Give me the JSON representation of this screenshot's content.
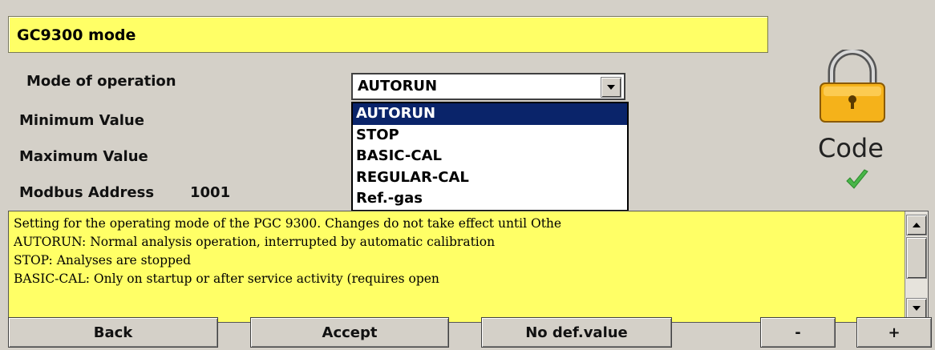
{
  "title": "GC9300 mode",
  "fields": {
    "mode_label": "Mode of operation",
    "min_label": "Minimum Value",
    "max_label": "Maximum Value",
    "modbus_label": "Modbus Address",
    "modbus_value": "1001"
  },
  "combo": {
    "selected": "AUTORUN",
    "options": [
      "AUTORUN",
      "STOP",
      "BASIC-CAL",
      "REGULAR-CAL",
      "Ref.-gas"
    ]
  },
  "right_panel": {
    "code_label": "Code",
    "lock_icon": "padlock-icon",
    "check_icon": "checkmark-icon",
    "lock_color": "#f5b21a",
    "check_color": "#49b649"
  },
  "description": {
    "lines": [
      "Setting for the operating mode of the PGC 9300. Changes do not take effect until Othe",
      "AUTORUN: Normal analysis operation, interrupted by automatic calibration",
      "STOP: Analyses are stopped",
      "BASIC-CAL: Only on startup or after service activity (requires open"
    ]
  },
  "buttons": {
    "back": "Back",
    "accept": "Accept",
    "no_def": "No def.value",
    "minus": "-",
    "plus": "+"
  },
  "colors": {
    "background": "#d4d0c8",
    "highlight_yellow": "#ffff66",
    "selection_blue": "#0a246a"
  }
}
